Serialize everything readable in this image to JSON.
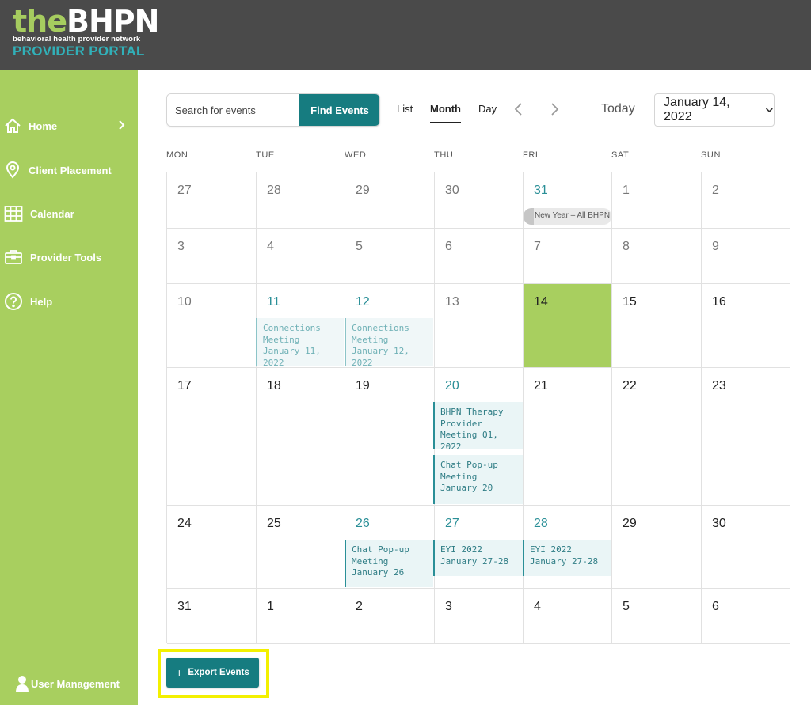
{
  "brand": {
    "name_prefix": "the",
    "name_main": "BHPN",
    "tagline": "behavioral health provider network",
    "portal": "PROVIDER PORTAL"
  },
  "sidebar": {
    "items": [
      {
        "label": "Home",
        "icon": "home-icon"
      },
      {
        "label": "Client Placement",
        "icon": "location-pin-icon"
      },
      {
        "label": "Calendar",
        "icon": "calendar-grid-icon"
      },
      {
        "label": "Provider Tools",
        "icon": "briefcase-icon"
      },
      {
        "label": "Help",
        "icon": "help-circle-icon"
      }
    ],
    "footer": {
      "label": "User Management",
      "icon": "user-icon"
    }
  },
  "toolbar": {
    "search_placeholder": "Search for events",
    "find_label": "Find Events",
    "views": [
      "List",
      "Month",
      "Day"
    ],
    "active_view": "Month",
    "today_label": "Today",
    "date_label": "January 14, 2022"
  },
  "calendar": {
    "weekdays": [
      "MON",
      "TUE",
      "WED",
      "THU",
      "FRI",
      "SAT",
      "SUN"
    ],
    "weeks": [
      [
        "27",
        "28",
        "29",
        "30",
        "31",
        "1",
        "2"
      ],
      [
        "3",
        "4",
        "5",
        "6",
        "7",
        "8",
        "9"
      ],
      [
        "10",
        "11",
        "12",
        "13",
        "14",
        "15",
        "16"
      ],
      [
        "17",
        "18",
        "19",
        "20",
        "21",
        "22",
        "23"
      ],
      [
        "24",
        "25",
        "26",
        "27",
        "28",
        "29",
        "30"
      ],
      [
        "31",
        "1",
        "2",
        "3",
        "4",
        "5",
        "6"
      ]
    ],
    "today": "14",
    "events": {
      "new_year": "New Year – All BHPN",
      "connections_11": "Connections Meeting January 11, 2022",
      "connections_12": "Connections Meeting January 12, 2022",
      "therapy_meeting": "BHPN Therapy Provider Meeting Q1, 2022",
      "chat_20": "Chat Pop-up Meeting January 20",
      "chat_26": "Chat Pop-up Meeting January 26",
      "eyi_27": "EYI 2022 January 27-28",
      "eyi_28": "EYI 2022 January 27-28"
    }
  },
  "actions": {
    "export_plus": "+",
    "export_label": "Export Events"
  },
  "colors": {
    "header_bg": "#4a4a4a",
    "sidebar_bg": "#a8cf5f",
    "accent_teal": "#167c80",
    "today_bg": "#a8cf5f",
    "highlight_frame": "#f3f000"
  }
}
